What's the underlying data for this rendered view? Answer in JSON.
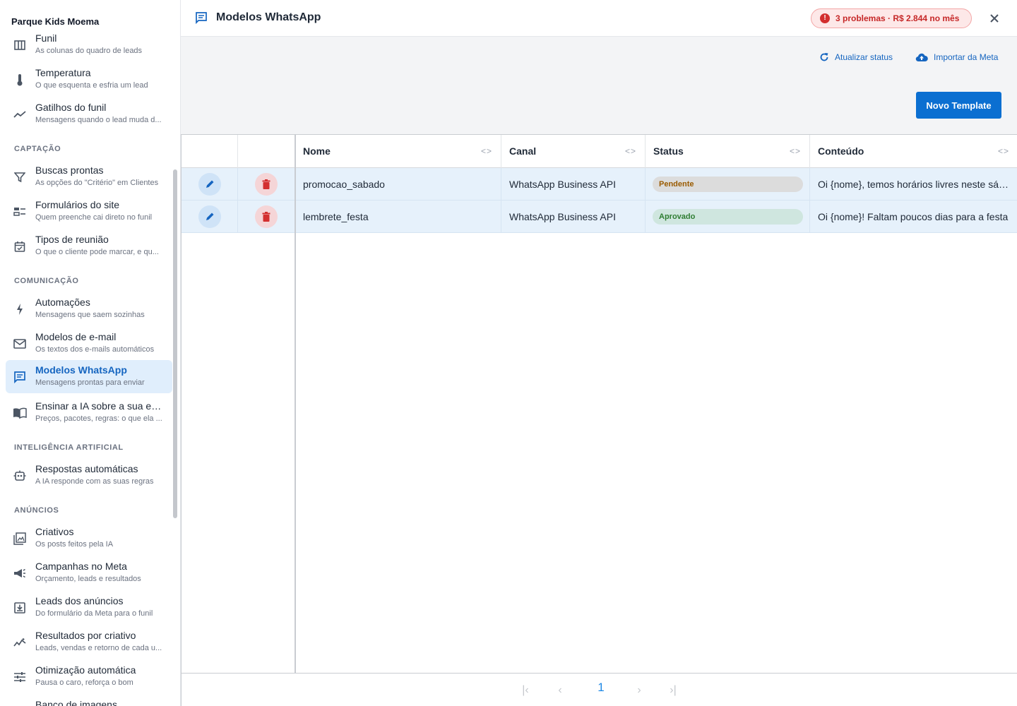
{
  "sidebar": {
    "org_name": "Parque Kids Moema",
    "collapse_glyph": "«",
    "sections": {
      "captacao": "CAPTAÇÃO",
      "comunicacao": "COMUNICAÇÃO",
      "ia": "INTELIGÊNCIA ARTIFICIAL",
      "anuncios": "ANÚNCIOS"
    },
    "items": [
      {
        "label": "Funil",
        "desc": "As colunas do quadro de leads",
        "icon": "columns-icon"
      },
      {
        "label": "Temperatura",
        "desc": "O que esquenta e esfria um lead",
        "icon": "thermometer-icon"
      },
      {
        "label": "Gatilhos do funil",
        "desc": "Mensagens quando o lead muda d...",
        "icon": "trend-line-icon"
      },
      {
        "label": "Buscas prontas",
        "desc": "As opções do \"Critério\" em Clientes",
        "icon": "filter-icon"
      },
      {
        "label": "Formulários do site",
        "desc": "Quem preenche cai direto no funil",
        "icon": "form-icon"
      },
      {
        "label": "Tipos de reunião",
        "desc": "O que o cliente pode marcar, e qu...",
        "icon": "calendar-check-icon"
      },
      {
        "label": "Automações",
        "desc": "Mensagens que saem sozinhas",
        "icon": "bolt-icon"
      },
      {
        "label": "Modelos de e-mail",
        "desc": "Os textos dos e-mails automáticos",
        "icon": "mail-icon"
      },
      {
        "label": "Modelos WhatsApp",
        "desc": "Mensagens prontas para enviar",
        "icon": "chat-icon"
      },
      {
        "label": "Ensinar a IA sobre a sua em...",
        "desc": "Preços, pacotes, regras: o que ela ...",
        "icon": "book-icon"
      },
      {
        "label": "Respostas automáticas",
        "desc": "A IA responde com as suas regras",
        "icon": "robot-icon"
      },
      {
        "label": "Criativos",
        "desc": "Os posts feitos pela IA",
        "icon": "image-icon"
      },
      {
        "label": "Campanhas no Meta",
        "desc": "Orçamento, leads e resultados",
        "icon": "megaphone-icon"
      },
      {
        "label": "Leads dos anúncios",
        "desc": "Do formulário da Meta para o funil",
        "icon": "download-box-icon"
      },
      {
        "label": "Resultados por criativo",
        "desc": "Leads, vendas e retorno de cada u...",
        "icon": "sparkline-icon"
      },
      {
        "label": "Otimização automática",
        "desc": "Pausa o caro, reforça o bom",
        "icon": "sliders-icon"
      },
      {
        "label": "Banco de imagens",
        "desc": "",
        "icon": "images-icon"
      }
    ]
  },
  "header": {
    "title": "Modelos WhatsApp",
    "problems_badge": "3 problemas · R$ 2.844 no mês",
    "problems_glyph": "!"
  },
  "actions": {
    "refresh_label": "Atualizar status",
    "import_label": "Importar da Meta",
    "new_template_label": "Novo Template"
  },
  "table": {
    "columns": [
      "Nome",
      "Canal",
      "Status",
      "Conteúdo"
    ],
    "resize_glyph": "<>",
    "rows": [
      {
        "nome": "promocao_sabado",
        "canal": "WhatsApp Business API",
        "status": "Pendente",
        "conteudo": "Oi {nome}, temos horários livres neste sábado"
      },
      {
        "nome": "lembrete_festa",
        "canal": "WhatsApp Business API",
        "status": "Aprovado",
        "conteudo": "Oi {nome}! Faltam poucos dias para a festa"
      }
    ]
  },
  "pagination": {
    "current_page": "1",
    "first_glyph": "|‹",
    "prev_glyph": "‹",
    "next_glyph": "›",
    "last_glyph": "›|"
  },
  "colors": {
    "accent": "#1565c0",
    "primary_button": "#0b6fd1",
    "row_highlight": "#e6f1fb",
    "danger": "#d32f2f"
  }
}
